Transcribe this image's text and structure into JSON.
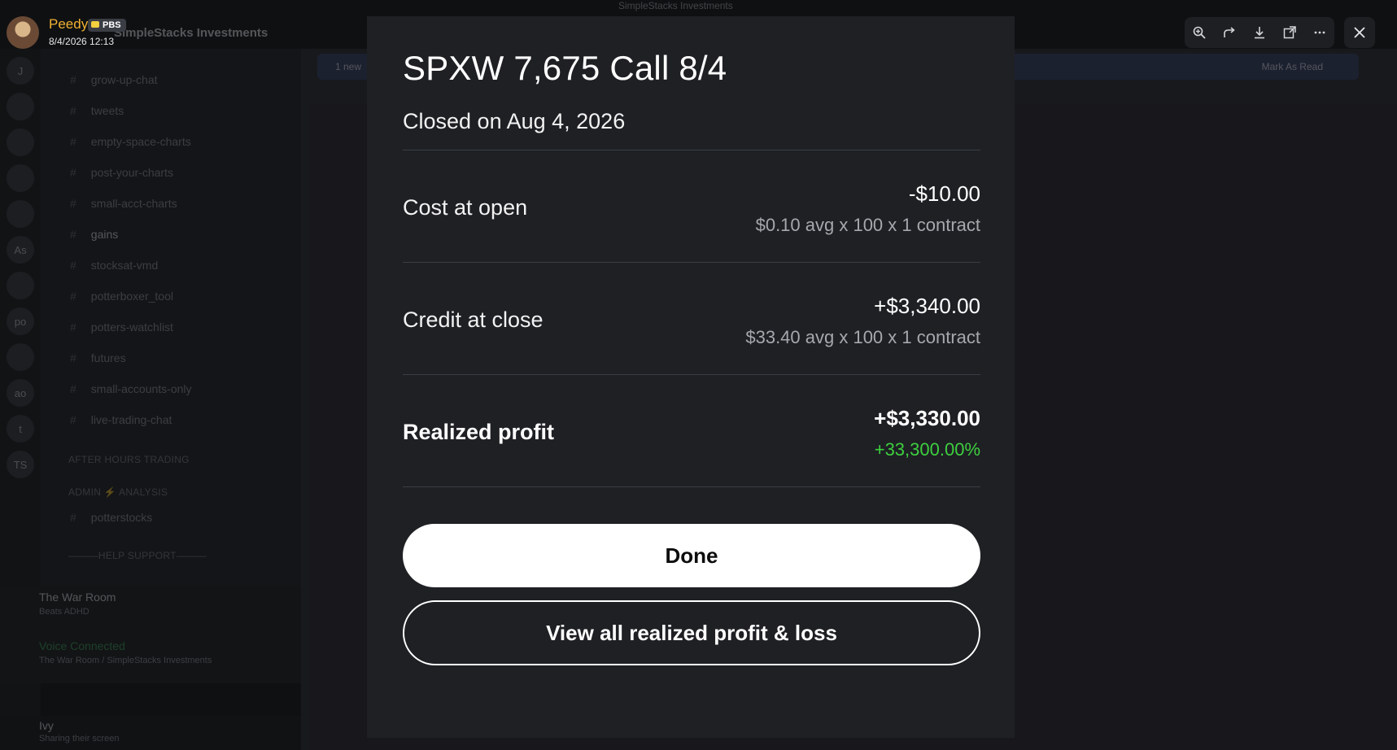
{
  "window": {
    "title": "SimpleStacks Investments"
  },
  "viewer": {
    "uploader_name": "Peedy",
    "uploader_badge": "PBS",
    "timestamp": "8/4/2026 12:13",
    "toolbar": {
      "icons": [
        "zoom-in-icon",
        "forward-icon",
        "download-icon",
        "open-external-icon",
        "more-icon"
      ],
      "close_icon": "close-icon"
    }
  },
  "background": {
    "server_name": "SimpleStacks Investments",
    "banner_left": "1 new",
    "banner_right": "Mark As Read",
    "categories": [
      "AFTER HOURS TRADING",
      "ADMIN ⚡ ANALYSIS",
      "———HELP SUPPORT———"
    ],
    "channels": [
      "grow-up-chat",
      "tweets",
      "empty-space-charts",
      "post-your-charts",
      "small-acct-charts",
      "gains",
      "stocksat-vmd",
      "potterboxer_tool",
      "potters-watchlist",
      "futures",
      "small-accounts-only",
      "live-trading-chat",
      "potterstocks"
    ],
    "voice_room": "The War Room",
    "voice_room_sub": "Beats ADHD",
    "voice_status": "Voice Connected",
    "voice_status_sub": "The War Room / SimpleStacks Investments",
    "current_user": "Ivy",
    "current_user_status": "Sharing their screen",
    "guild_letters": [
      "J",
      "As",
      "po",
      "ao",
      "t",
      "TS"
    ]
  },
  "modal": {
    "title": "SPXW 7,675 Call 8/4",
    "subtitle": "Closed on Aug 4, 2026",
    "rows": [
      {
        "label": "Cost at open",
        "value": "-$10.00",
        "detail": "$0.10 avg x 100 x 1 contract"
      },
      {
        "label": "Credit at close",
        "value": "+$3,340.00",
        "detail": "$33.40 avg x 100 x 1 contract"
      },
      {
        "label": "Realized profit",
        "value": "+$3,330.00",
        "detail": "+33,300.00%"
      }
    ],
    "done_label": "Done",
    "view_all_label": "View all realized profit & loss",
    "colors": {
      "background": "#1e2024",
      "profit_green": "#3ecf3e"
    }
  }
}
